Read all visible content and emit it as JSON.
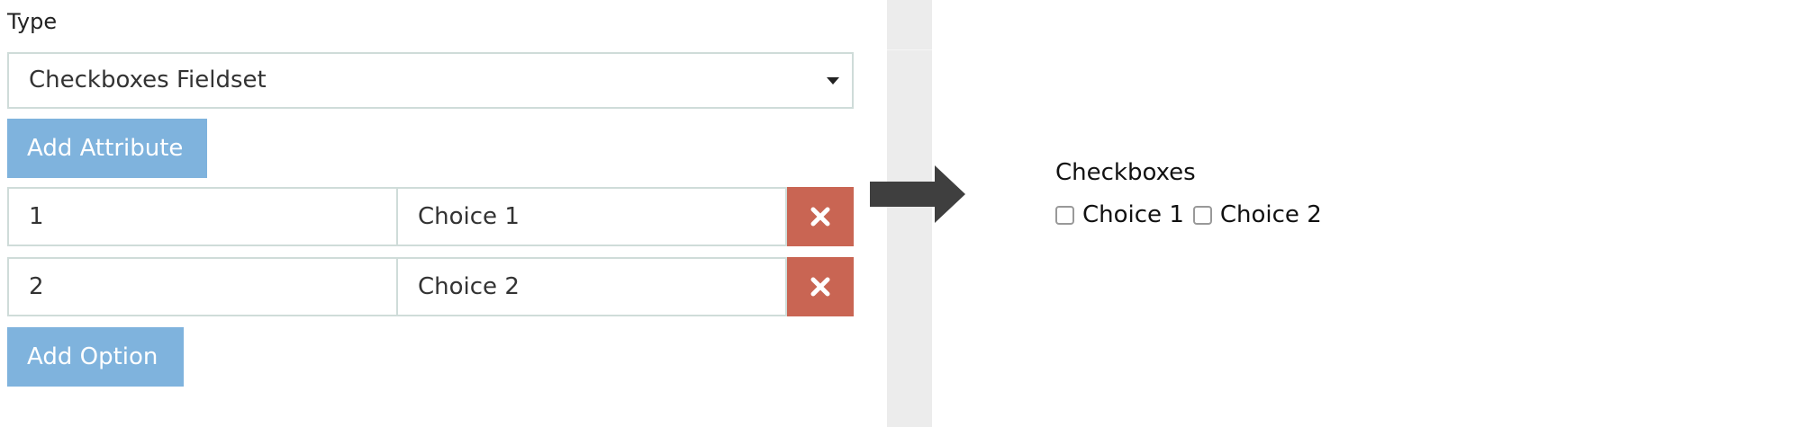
{
  "form": {
    "type_label": "Type",
    "type_select": {
      "value": "Checkboxes Fieldset"
    },
    "add_attribute_label": "Add Attribute",
    "options": [
      {
        "key": "1",
        "value": "Choice 1"
      },
      {
        "key": "2",
        "value": "Choice 2"
      }
    ],
    "add_option_label": "Add Option"
  },
  "icons": {
    "remove": "close-icon",
    "caret": "caret-down-icon",
    "arrow": "arrow-right-icon"
  },
  "preview": {
    "title": "Checkboxes",
    "options": [
      {
        "label": "Choice 1",
        "checked": false
      },
      {
        "label": "Choice 2",
        "checked": false
      }
    ]
  },
  "colors": {
    "button_blue": "#7fb3dd",
    "remove_red": "#c96553",
    "border": "#cfdcd9",
    "divider_gray": "#ececec"
  }
}
